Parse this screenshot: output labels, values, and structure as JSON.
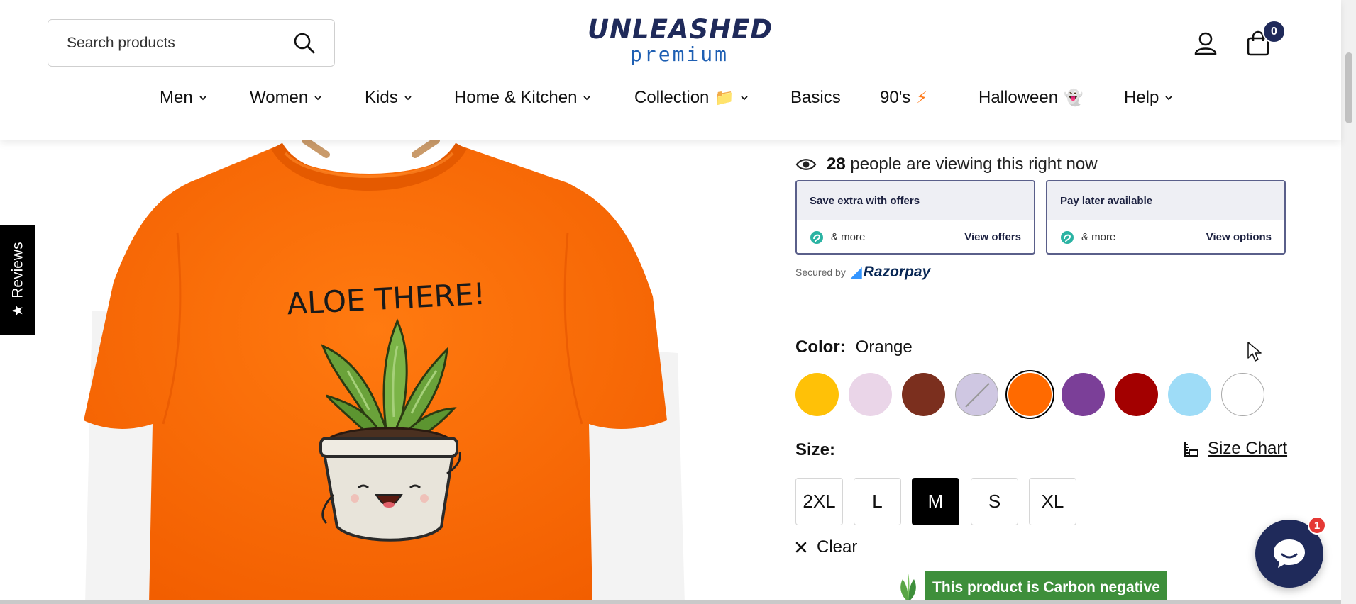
{
  "search": {
    "placeholder": "Search products"
  },
  "logo": {
    "top": "UNLEASHED",
    "bottom": "premium"
  },
  "cart": {
    "count": "0"
  },
  "nav": {
    "items": [
      {
        "label": "Men",
        "has_chevron": true
      },
      {
        "label": "Women",
        "has_chevron": true
      },
      {
        "label": "Kids",
        "has_chevron": true
      },
      {
        "label": "Home & Kitchen",
        "has_chevron": true
      },
      {
        "label": "Collection",
        "emoji": "📁",
        "has_chevron": true
      },
      {
        "label": "Basics",
        "has_chevron": false
      },
      {
        "label": "90's",
        "emoji": "⚡",
        "has_chevron": false
      },
      {
        "label": "Halloween",
        "emoji": "👻",
        "has_chevron": false
      },
      {
        "label": "Help",
        "has_chevron": true
      }
    ]
  },
  "reviews_tab": {
    "label": "Reviews",
    "star": "★"
  },
  "product": {
    "print_text": "ALOE THERE!",
    "shirt_color": "#ff6a00"
  },
  "viewing": {
    "count": "28",
    "text": "people are viewing this right now"
  },
  "offers": [
    {
      "title": "Save extra with offers",
      "more": "& more",
      "link": "View offers"
    },
    {
      "title": "Pay later available",
      "more": "& more",
      "link": "View options"
    }
  ],
  "secured": {
    "label": "Secured by",
    "brand": "Razorpay"
  },
  "color": {
    "label": "Color:",
    "selected": "Orange",
    "swatches": [
      {
        "name": "Yellow",
        "hex": "#ffc107"
      },
      {
        "name": "Light Pink",
        "hex": "#ead5e8"
      },
      {
        "name": "Brown",
        "hex": "#7b2f1e"
      },
      {
        "name": "Lavender",
        "hex": "#cfc7e2",
        "unavailable": true
      },
      {
        "name": "Orange",
        "hex": "#ff6a00",
        "selected": true
      },
      {
        "name": "Purple",
        "hex": "#7b3f98"
      },
      {
        "name": "Red",
        "hex": "#a30000"
      },
      {
        "name": "Sky Blue",
        "hex": "#9edcf7"
      },
      {
        "name": "White",
        "hex": "#ffffff"
      }
    ]
  },
  "size": {
    "label": "Size:",
    "chart_label": "Size Chart",
    "options": [
      "2XL",
      "L",
      "M",
      "S",
      "XL"
    ],
    "selected": "M",
    "clear_label": "Clear"
  },
  "carbon": {
    "text": "This product is Carbon negative"
  },
  "chat": {
    "badge": "1"
  },
  "colors": {
    "brand_navy": "#1f2a5a",
    "carbon_green": "#3e8f3b",
    "badge_red": "#e53935"
  }
}
